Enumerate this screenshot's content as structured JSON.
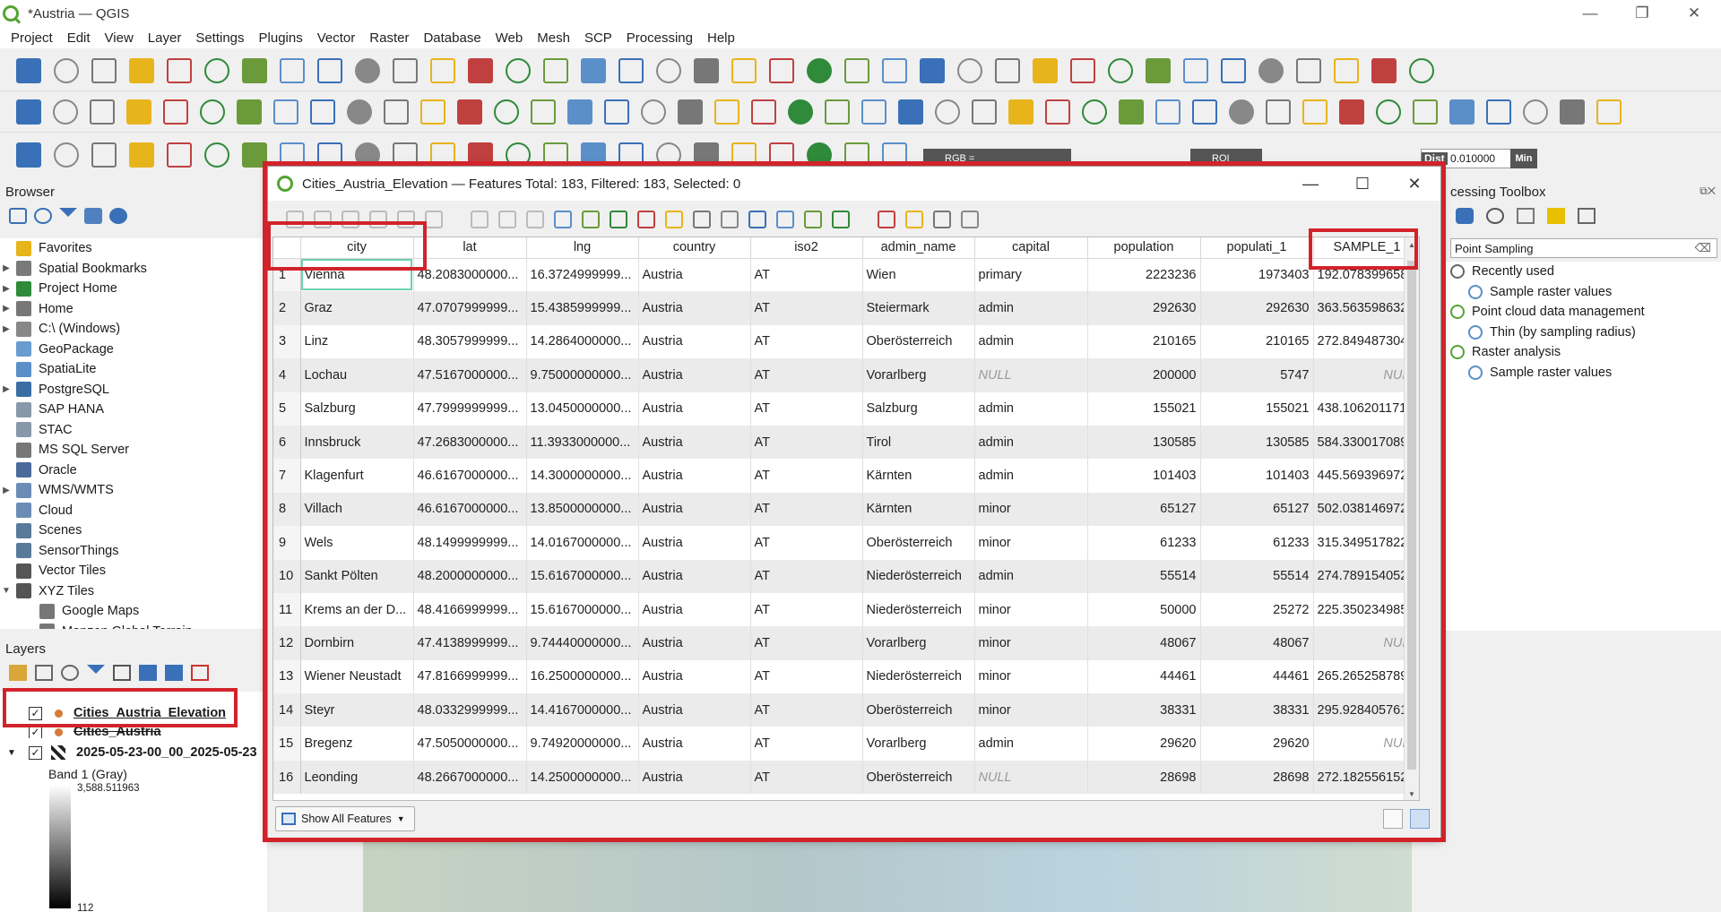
{
  "window": {
    "title": "*Austria — QGIS"
  },
  "menu": [
    "Project",
    "Edit",
    "View",
    "Layer",
    "Settings",
    "Plugins",
    "Vector",
    "Raster",
    "Database",
    "Web",
    "Mesh",
    "SCP",
    "Processing",
    "Help"
  ],
  "toolbar_widgets": {
    "rgb_label": "RGB =",
    "roi_label": "ROI",
    "dist_label": "Dist",
    "dist_value": "0.010000",
    "min_label": "Min"
  },
  "browser": {
    "title": "Browser",
    "items": [
      {
        "label": "Favorites",
        "icon": "star-icon",
        "color": "#e8b41c"
      },
      {
        "label": "Spatial Bookmarks",
        "icon": "bookmark-icon",
        "color": "#7a7a7a"
      },
      {
        "label": "Project Home",
        "icon": "folder-icon",
        "color": "#2f8a3a"
      },
      {
        "label": "Home",
        "icon": "folder-icon",
        "color": "#777777"
      },
      {
        "label": "C:\\ (Windows)",
        "icon": "drive-icon",
        "color": "#888888"
      },
      {
        "label": "GeoPackage",
        "icon": "geopackage-icon",
        "color": "#6a9bd1"
      },
      {
        "label": "SpatiaLite",
        "icon": "spatialite-icon",
        "color": "#5a8fc9"
      },
      {
        "label": "PostgreSQL",
        "icon": "postgresql-icon",
        "color": "#3a6ea5"
      },
      {
        "label": "SAP HANA",
        "icon": "sap-hana-icon",
        "color": "#8898aa"
      },
      {
        "label": "STAC",
        "icon": "stac-icon",
        "color": "#8898aa"
      },
      {
        "label": "MS SQL Server",
        "icon": "mssql-icon",
        "color": "#777777"
      },
      {
        "label": "Oracle",
        "icon": "oracle-icon",
        "color": "#4a6a9a"
      },
      {
        "label": "WMS/WMTS",
        "icon": "globe-icon",
        "color": "#6b8db5"
      },
      {
        "label": "Cloud",
        "icon": "cloud-icon",
        "color": "#6b8db5"
      },
      {
        "label": "Scenes",
        "icon": "scenes-icon",
        "color": "#5a7a9a"
      },
      {
        "label": "SensorThings",
        "icon": "sensor-icon",
        "color": "#5a7a9a"
      },
      {
        "label": "Vector Tiles",
        "icon": "vector-tiles-icon",
        "color": "#555555"
      },
      {
        "label": "XYZ Tiles",
        "icon": "xyz-tiles-icon",
        "color": "#555555"
      },
      {
        "label": "Google Maps",
        "icon": "xyz-tiles-icon",
        "color": "#777777"
      },
      {
        "label": "Mapzen Global Terrain",
        "icon": "xyz-tiles-icon",
        "color": "#777777"
      }
    ]
  },
  "layers": {
    "title": "Layers",
    "items": [
      {
        "label": "Cities_Austria_Elevation"
      },
      {
        "label": "Cities_Austria"
      },
      {
        "label": "2025-05-23-00_00_2025-05-23"
      },
      {
        "label": "Band 1 (Gray)"
      }
    ],
    "legend_max": "3,588.511963",
    "legend_min": "112"
  },
  "processing": {
    "title": "cessing Toolbox",
    "search": "Point Sampling",
    "items": [
      {
        "label": "Recently used",
        "icon": "clock-icon",
        "level": 0
      },
      {
        "label": "Sample raster values",
        "icon": "gear-icon",
        "level": 1
      },
      {
        "label": "Point cloud data management",
        "icon": "qgis-icon",
        "level": 0
      },
      {
        "label": "Thin (by sampling radius)",
        "icon": "gear-icon",
        "level": 1
      },
      {
        "label": "Raster analysis",
        "icon": "qgis-icon",
        "level": 0
      },
      {
        "label": "Sample raster values",
        "icon": "gear-icon",
        "level": 1
      }
    ]
  },
  "attribute_table": {
    "title": "Cities_Austria_Elevation — Features Total: 183, Filtered: 183, Selected: 0",
    "columns": [
      "city",
      "lat",
      "lng",
      "country",
      "iso2",
      "admin_name",
      "capital",
      "population",
      "populati_1",
      "SAMPLE_1"
    ],
    "rows": [
      [
        "1",
        "Vienna",
        "48.2083000000...",
        "16.3724999999...",
        "Austria",
        "AT",
        "Wien",
        "primary",
        "2223236",
        "1973403",
        "192.078399658..."
      ],
      [
        "2",
        "Graz",
        "47.0707999999...",
        "15.4385999999...",
        "Austria",
        "AT",
        "Steiermark",
        "admin",
        "292630",
        "292630",
        "363.563598632..."
      ],
      [
        "3",
        "Linz",
        "48.3057999999...",
        "14.2864000000...",
        "Austria",
        "AT",
        "Oberösterreich",
        "admin",
        "210165",
        "210165",
        "272.849487304..."
      ],
      [
        "4",
        "Lochau",
        "47.5167000000...",
        "9.75000000000...",
        "Austria",
        "AT",
        "Vorarlberg",
        "NULL",
        "200000",
        "5747",
        "NULL"
      ],
      [
        "5",
        "Salzburg",
        "47.7999999999...",
        "13.0450000000...",
        "Austria",
        "AT",
        "Salzburg",
        "admin",
        "155021",
        "155021",
        "438.106201171..."
      ],
      [
        "6",
        "Innsbruck",
        "47.2683000000...",
        "11.3933000000...",
        "Austria",
        "AT",
        "Tirol",
        "admin",
        "130585",
        "130585",
        "584.330017089..."
      ],
      [
        "7",
        "Klagenfurt",
        "46.6167000000...",
        "14.3000000000...",
        "Austria",
        "AT",
        "Kärnten",
        "admin",
        "101403",
        "101403",
        "445.569396972..."
      ],
      [
        "8",
        "Villach",
        "46.6167000000...",
        "13.8500000000...",
        "Austria",
        "AT",
        "Kärnten",
        "minor",
        "65127",
        "65127",
        "502.038146972..."
      ],
      [
        "9",
        "Wels",
        "48.1499999999...",
        "14.0167000000...",
        "Austria",
        "AT",
        "Oberösterreich",
        "minor",
        "61233",
        "61233",
        "315.349517822..."
      ],
      [
        "10",
        "Sankt Pölten",
        "48.2000000000...",
        "15.6167000000...",
        "Austria",
        "AT",
        "Niederösterreich",
        "admin",
        "55514",
        "55514",
        "274.789154052..."
      ],
      [
        "11",
        "Krems an der D...",
        "48.4166999999...",
        "15.6167000000...",
        "Austria",
        "AT",
        "Niederösterreich",
        "minor",
        "50000",
        "25272",
        "225.350234985..."
      ],
      [
        "12",
        "Dornbirn",
        "47.4138999999...",
        "9.74440000000...",
        "Austria",
        "AT",
        "Vorarlberg",
        "minor",
        "48067",
        "48067",
        "NULL"
      ],
      [
        "13",
        "Wiener Neustadt",
        "47.8166999999...",
        "16.2500000000...",
        "Austria",
        "AT",
        "Niederösterreich",
        "minor",
        "44461",
        "44461",
        "265.265258789..."
      ],
      [
        "14",
        "Steyr",
        "48.0332999999...",
        "14.4167000000...",
        "Austria",
        "AT",
        "Oberösterreich",
        "minor",
        "38331",
        "38331",
        "295.928405761..."
      ],
      [
        "15",
        "Bregenz",
        "47.5050000000...",
        "9.74920000000...",
        "Austria",
        "AT",
        "Vorarlberg",
        "admin",
        "29620",
        "29620",
        "NULL"
      ],
      [
        "16",
        "Leonding",
        "48.2667000000...",
        "14.2500000000...",
        "Austria",
        "AT",
        "Oberösterreich",
        "NULL",
        "28698",
        "28698",
        "272.182556152..."
      ]
    ],
    "footer_button": "Show All Features"
  },
  "colors": {
    "highlight": "#d2232a",
    "qgis_green": "#53a432"
  }
}
